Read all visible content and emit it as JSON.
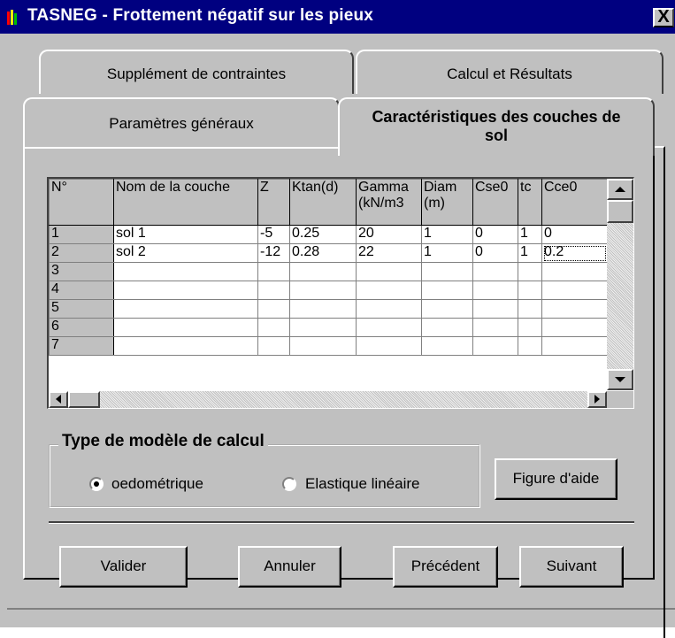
{
  "window": {
    "title": "TASNEG - Frottement négatif sur les pieux",
    "close_label": "X"
  },
  "tabs": {
    "back": [
      {
        "label": "Supplément de contraintes"
      },
      {
        "label": "Calcul et Résultats"
      }
    ],
    "front": [
      {
        "label": "Paramètres généraux"
      }
    ],
    "active": {
      "label_line1": "Caractéristiques des couches de",
      "label_line2": "sol"
    }
  },
  "grid": {
    "columns": [
      {
        "label": "N°"
      },
      {
        "label": "Nom de la couche"
      },
      {
        "label": "Z"
      },
      {
        "label": "Ktan(d)"
      },
      {
        "label": "Gamma",
        "label2": "(kN/m3"
      },
      {
        "label": "Diam",
        "label2": "(m)"
      },
      {
        "label": "Cse0"
      },
      {
        "label": "tc"
      },
      {
        "label": "Cce0"
      }
    ],
    "rows": [
      [
        "1",
        "sol 1",
        "-5",
        "0.25",
        "20",
        "1",
        "0",
        "1",
        "0"
      ],
      [
        "2",
        "sol 2",
        "-12",
        "0.28",
        "22",
        "1",
        "0",
        "1",
        "0.2"
      ],
      [
        "3",
        "",
        "",
        "",
        "",
        "",
        "",
        "",
        ""
      ],
      [
        "4",
        "",
        "",
        "",
        "",
        "",
        "",
        "",
        ""
      ],
      [
        "5",
        "",
        "",
        "",
        "",
        "",
        "",
        "",
        ""
      ],
      [
        "6",
        "",
        "",
        "",
        "",
        "",
        "",
        "",
        ""
      ],
      [
        "7",
        "",
        "",
        "",
        "",
        "",
        "",
        "",
        ""
      ]
    ]
  },
  "model_group": {
    "title": "Type de modèle de calcul",
    "options": [
      {
        "label": "oedométrique",
        "selected": true
      },
      {
        "label": "Elastique linéaire",
        "selected": false
      }
    ]
  },
  "buttons": {
    "help": "Figure d'aide",
    "validate": "Valider",
    "cancel": "Annuler",
    "previous": "Précédent",
    "next": "Suivant"
  },
  "colors": {
    "titlebar": "#000080",
    "face": "#c0c0c0"
  }
}
